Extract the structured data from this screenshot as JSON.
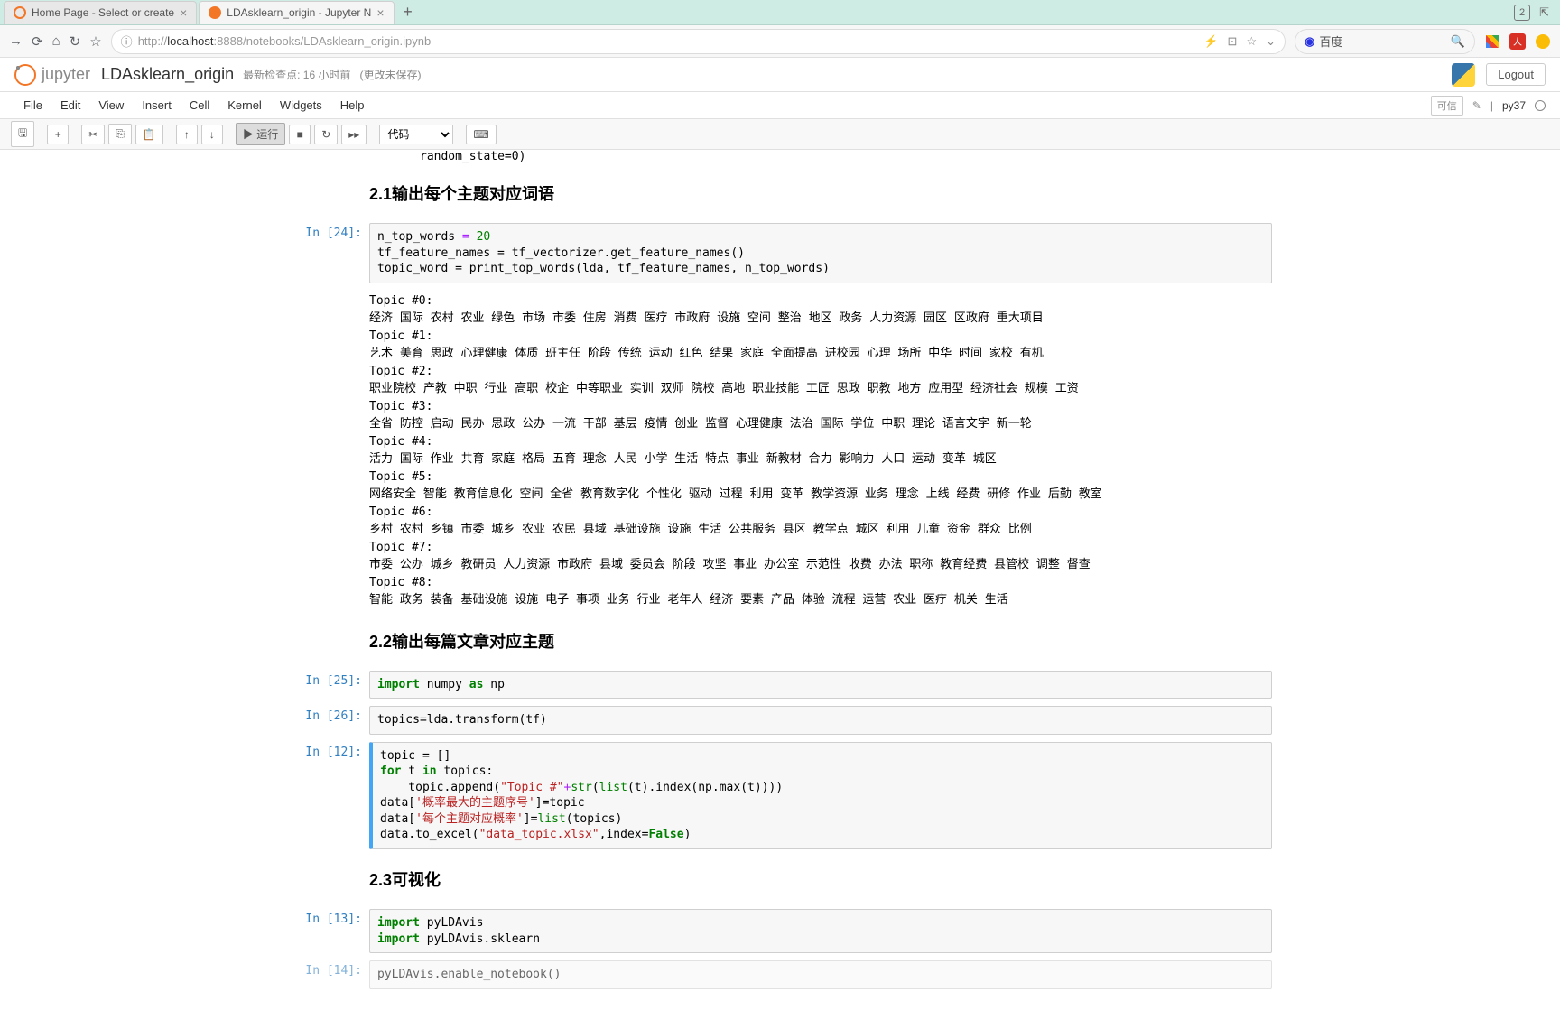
{
  "browser": {
    "tabs": [
      {
        "title": "Home Page - Select or create",
        "active": false
      },
      {
        "title": "LDAsklearn_origin - Jupyter N",
        "active": true
      }
    ],
    "tab_counter": "2",
    "url_host": "localhost",
    "url_port": ":8888",
    "url_path": "/notebooks/LDAsklearn_origin.ipynb",
    "url_scheme": "http://",
    "search_label": "百度"
  },
  "jupyter": {
    "logo_text": "jupyter",
    "title": "LDAsklearn_origin",
    "checkpoint": "最新检查点: 16 小时前",
    "unsaved": "(更改未保存)",
    "logout": "Logout",
    "menu": [
      "File",
      "Edit",
      "View",
      "Insert",
      "Cell",
      "Kernel",
      "Widgets",
      "Help"
    ],
    "trusted": "可信",
    "kernel": "py37",
    "toolbar": {
      "run_label": "运行",
      "celltype": "代码"
    }
  },
  "cells": {
    "remnant": "                          random_state=0)",
    "h21": "2.1输出每个主题对应词语",
    "in24_prompt": "In [24]:",
    "in24_code_l1a": "n_top_words ",
    "in24_code_l1b": " 20",
    "in24_code_l2": "tf_feature_names = tf_vectorizer.get_feature_names()",
    "in24_code_l3": "topic_word = print_top_words(lda, tf_feature_names, n_top_words)",
    "out24": "Topic #0:\n经济 国际 农村 农业 绿色 市场 市委 住房 消费 医疗 市政府 设施 空间 整治 地区 政务 人力资源 园区 区政府 重大项目\nTopic #1:\n艺术 美育 思政 心理健康 体质 班主任 阶段 传统 运动 红色 结果 家庭 全面提高 进校园 心理 场所 中华 时间 家校 有机\nTopic #2:\n职业院校 产教 中职 行业 高职 校企 中等职业 实训 双师 院校 高地 职业技能 工匠 思政 职教 地方 应用型 经济社会 规模 工资\nTopic #3:\n全省 防控 启动 民办 思政 公办 一流 干部 基层 疫情 创业 监督 心理健康 法治 国际 学位 中职 理论 语言文字 新一轮\nTopic #4:\n活力 国际 作业 共育 家庭 格局 五育 理念 人民 小学 生活 特点 事业 新教材 合力 影响力 人口 运动 变革 城区\nTopic #5:\n网络安全 智能 教育信息化 空间 全省 教育数字化 个性化 驱动 过程 利用 变革 教学资源 业务 理念 上线 经费 研修 作业 后勤 教室\nTopic #6:\n乡村 农村 乡镇 市委 城乡 农业 农民 县域 基础设施 设施 生活 公共服务 县区 教学点 城区 利用 儿童 资金 群众 比例\nTopic #7:\n市委 公办 城乡 教研员 人力资源 市政府 县域 委员会 阶段 攻坚 事业 办公室 示范性 收费 办法 职称 教育经费 县管校 调整 督查\nTopic #8:\n智能 政务 装备 基础设施 设施 电子 事项 业务 行业 老年人 经济 要素 产品 体验 流程 运营 农业 医疗 机关 生活",
    "h22": "2.2输出每篇文章对应主题",
    "in25_prompt": "In [25]:",
    "in25_a": "import",
    "in25_b": " numpy ",
    "in25_c": "as",
    "in25_d": " np",
    "in26_prompt": "In [26]:",
    "in26": "topics=lda.transform(tf)",
    "in12_prompt": "In [12]:",
    "in12_l1": "topic = []",
    "in12_l2a": "for",
    "in12_l2b": " t ",
    "in12_l2c": "in",
    "in12_l2d": " topics:",
    "in12_l3a": "    topic.append(",
    "in12_l3b": "\"Topic #\"",
    "in12_l3c": "+",
    "in12_l3d": "str",
    "in12_l3e": "(",
    "in12_l3f": "list",
    "in12_l3g": "(t).index(np.max(t))))",
    "in12_l4a": "data[",
    "in12_l4b": "'概率最大的主题序号'",
    "in12_l4c": "]=topic",
    "in12_l5a": "data[",
    "in12_l5b": "'每个主题对应概率'",
    "in12_l5c": "]=",
    "in12_l5d": "list",
    "in12_l5e": "(topics)",
    "in12_l6a": "data.to_excel(",
    "in12_l6b": "\"data_topic.xlsx\"",
    "in12_l6c": ",index=",
    "in12_l6d": "False",
    "in12_l6e": ")",
    "h23": "2.3可视化",
    "in13_prompt": "In [13]:",
    "in13_l1a": "import",
    "in13_l1b": " pyLDAvis",
    "in13_l2a": "import",
    "in13_l2b": " pyLDAvis.sklearn",
    "in14_prompt": "In [14]:",
    "in14": "pyLDAvis.enable_notebook()"
  }
}
